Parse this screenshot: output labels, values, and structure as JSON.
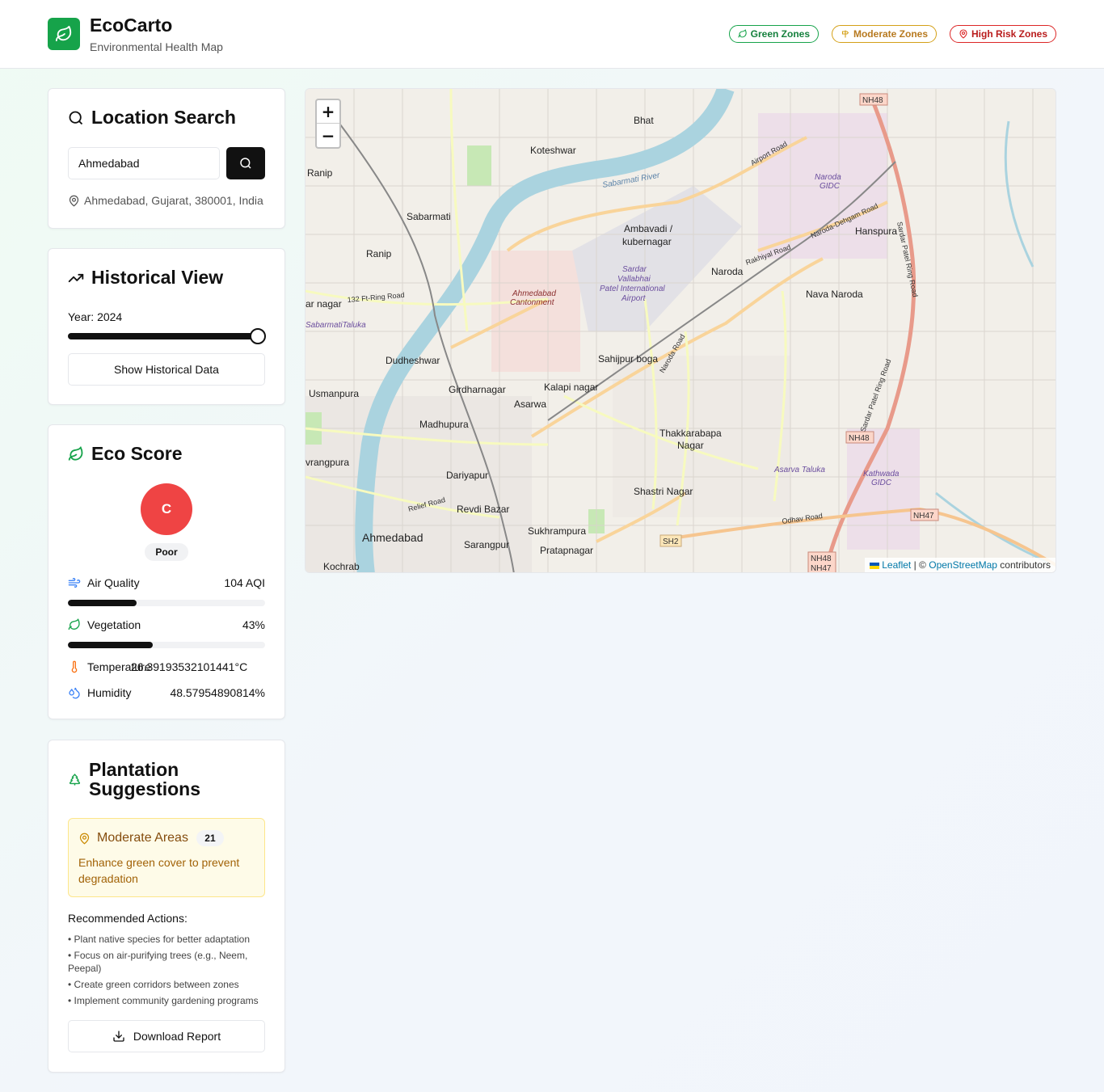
{
  "header": {
    "title": "EcoCarto",
    "subtitle": "Environmental Health Map",
    "badges": {
      "green": "Green Zones",
      "moderate": "Moderate Zones",
      "high": "High Risk Zones"
    }
  },
  "search": {
    "title": "Location Search",
    "value": "Ahmedabad",
    "location": "Ahmedabad, Gujarat, 380001, India"
  },
  "historical": {
    "title": "Historical View",
    "year_label": "Year: 2024",
    "button": "Show Historical Data"
  },
  "eco_score": {
    "title": "Eco Score",
    "grade": "C",
    "rating": "Poor",
    "grade_color": "#ef4444",
    "metrics": [
      {
        "label": "Air Quality",
        "value": "104 AQI",
        "bar_fraction": 0.35
      },
      {
        "label": "Vegetation",
        "value": "43%",
        "bar_fraction": 0.43
      },
      {
        "label": "Temperature",
        "value": "26.39193532101441°C"
      },
      {
        "label": "Humidity",
        "value": "48.57954890814%"
      }
    ]
  },
  "plantation": {
    "title": "Plantation Suggestions",
    "zone_label": "Moderate Areas",
    "zone_count": "21",
    "zone_desc": "Enhance green cover to prevent degradation",
    "actions_title": "Recommended Actions:",
    "actions": [
      "• Plant native species for better adaptation",
      "• Focus on air-purifying trees (e.g., Neem, Peepal)",
      "• Create green corridors between zones",
      "• Implement community gardening programs"
    ],
    "download": "Download Report"
  },
  "map": {
    "zoom_in": "+",
    "zoom_out": "−",
    "attribution": {
      "leaflet": "Leaflet",
      "sep": "| ©",
      "osm": "OpenStreetMap",
      "suffix": "contributors"
    },
    "places": {
      "ahmedabad": "Ahmedabad",
      "naroda": "Naroda",
      "nava_naroda": "Nava Naroda",
      "sabarmati": "Sabarmati",
      "ranip": "Ranip",
      "ranip2": "Ranip",
      "koteshwar": "Koteshwar",
      "bhat": "Bhat",
      "ambavadi": "Ambavadi /",
      "kubernagar": "kubernagar",
      "dudheshwar": "Dudheshwar",
      "usmanpura": "Usmanpura",
      "girdharnagar": "Girdharnagar",
      "asarwa": "Asarwa",
      "madhupura": "Madhupura",
      "kalapi": "Kalapi nagar",
      "sahijpur": "Sahijpur boga",
      "thakkarbapa": "Thakkarabapa",
      "nagar": "Nagar",
      "shastri": "Shastri Nagar",
      "dariyapur": "Dariyapur",
      "revdi": "Revdi Bazar",
      "sukhrampura": "Sukhrampura",
      "pratapnagar": "Pratapnagar",
      "sarangpur": "Sarangpur",
      "kochrab": "Kochrab",
      "hanspura": "Hanspura",
      "navrangpura": "vrangpura",
      "nagar_w": "ar nagar",
      "cantonment1": "Ahmedabad",
      "cantonment2": "Cantonment",
      "airport1": "Sardar",
      "airport2": "Vallabhai",
      "airport3": "Patel International",
      "airport4": "Airport",
      "gidc1": "Naroda",
      "gidc2": "GIDC",
      "kath1": "Kathwada",
      "kath2": "GIDC",
      "river": "Sabarmati River",
      "taluka": "SabarmatiTaluka",
      "asarva_taluka": "Asarva Taluka",
      "nh48a": "NH48",
      "nh48b": "NH48",
      "nh47": "NH47",
      "nh48c": "NH48",
      "nh47b": "NH47",
      "sh2": "SH2",
      "ring_road": "Sardar Patel Ring Road",
      "ring_road2": "Sardar Patel Ring Road",
      "airport_road": "Airport Road",
      "naroda_road": "Naroda Road",
      "rakhiyal_road": "Rakhiyal Road",
      "odhav_road": "Odhav Road",
      "relief_road": "Relief Road",
      "ring132": "132 Ft-Ring Road",
      "dehgam": "Naroda-Dehgam Road"
    }
  }
}
